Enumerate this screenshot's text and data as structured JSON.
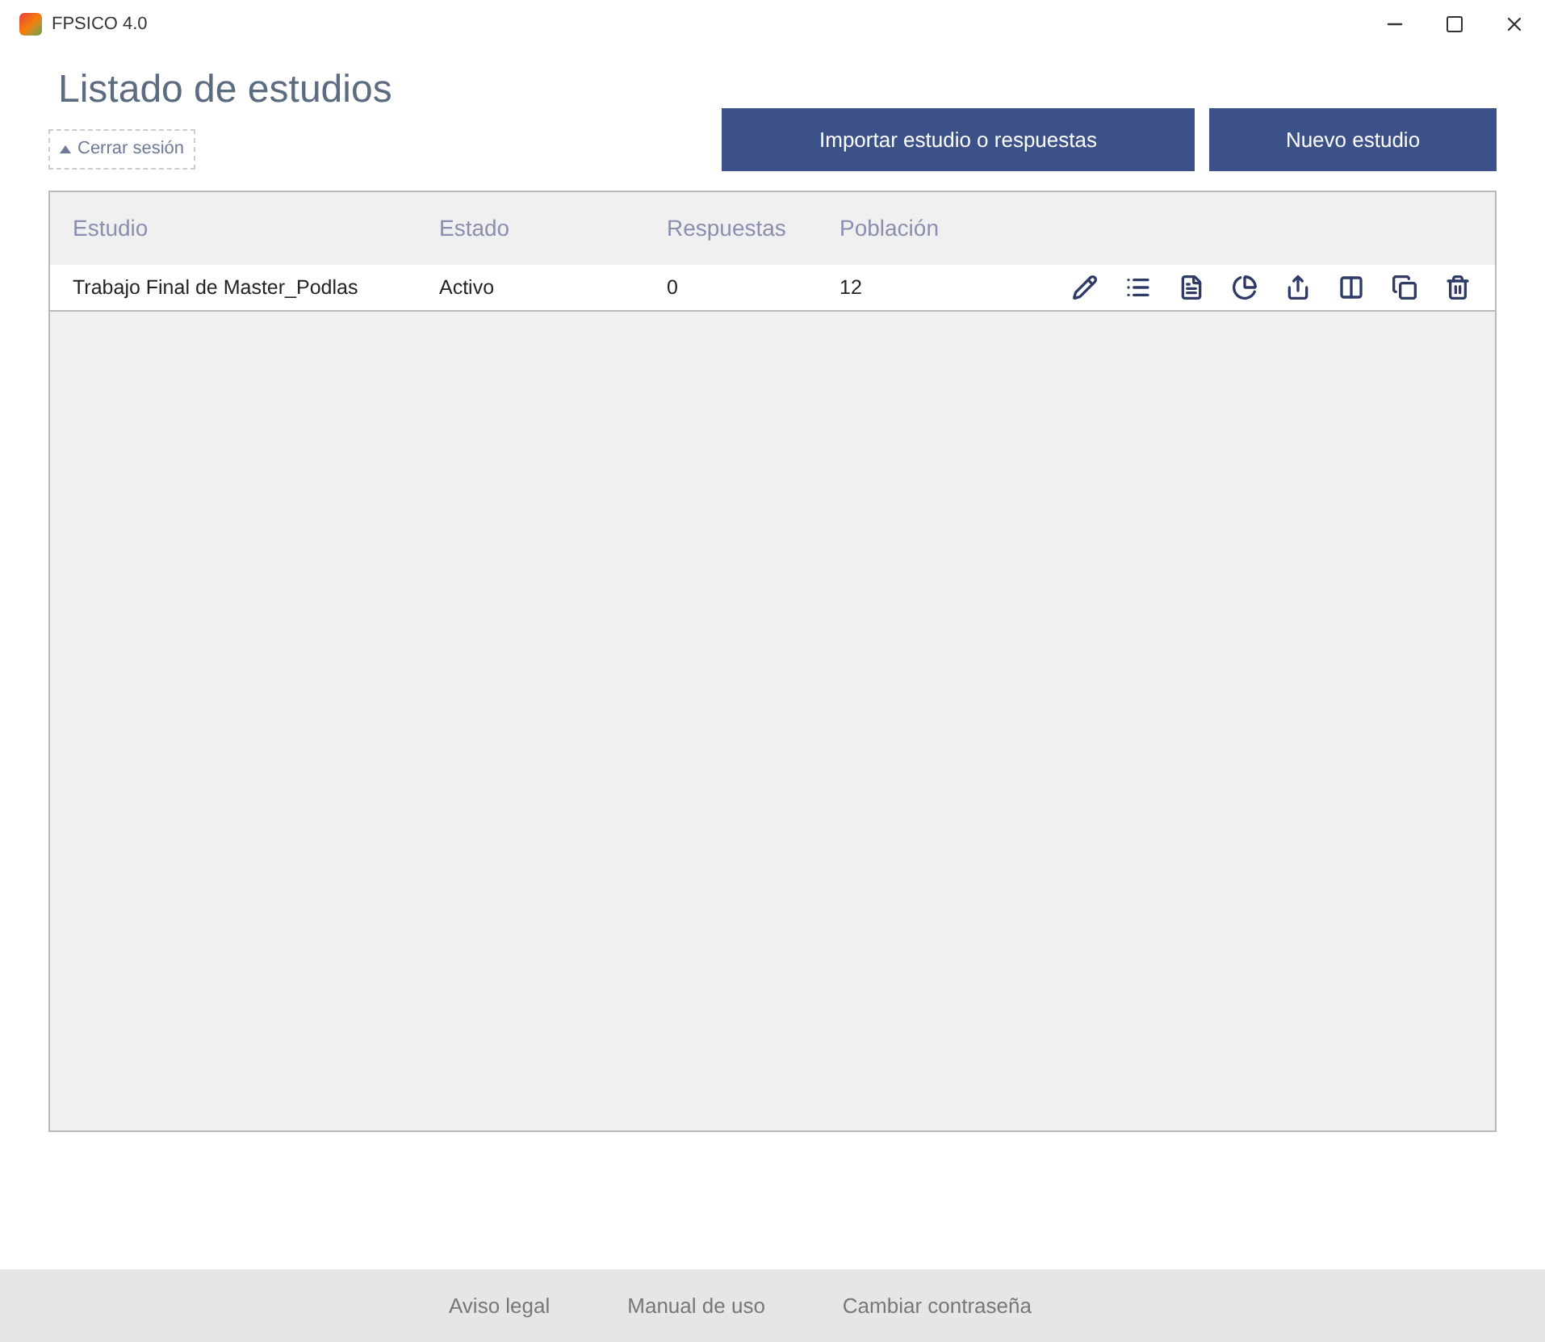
{
  "window": {
    "title": "FPSICO 4.0"
  },
  "page_title": "Listado de estudios",
  "logout_link": "Cerrar sesión",
  "buttons": [
    "Importar estudio o respuestas",
    "Nuevo estudio"
  ],
  "table": {
    "columns": [
      "Estudio",
      "Estado",
      "Respuestas",
      "Población"
    ],
    "rows": [
      {
        "cells": [
          "Trabajo Final de Master_Podlas",
          "Activo",
          "0",
          "12"
        ]
      }
    ]
  },
  "footer_links": [
    "Aviso legal",
    "Manual de uso",
    "Cambiar contraseña"
  ]
}
